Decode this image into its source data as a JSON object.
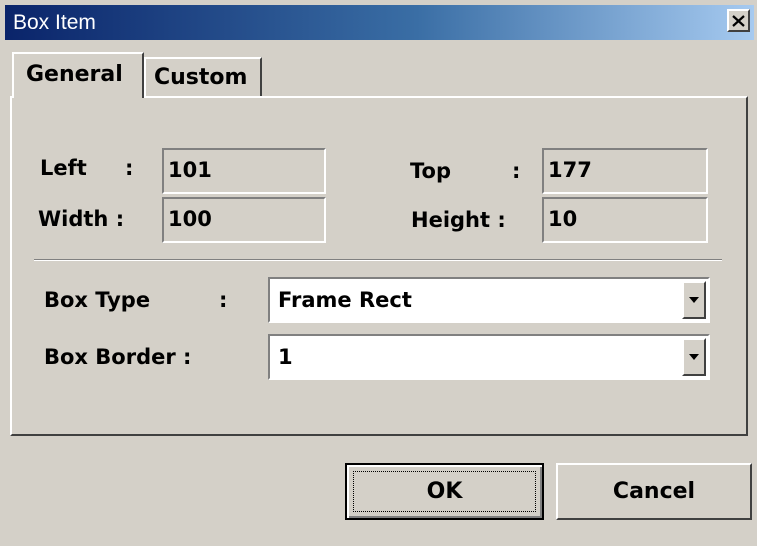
{
  "window": {
    "title": "Box Item",
    "close_glyph": "✕"
  },
  "tabs": [
    {
      "label": "General",
      "active": true
    },
    {
      "label": "Custom",
      "active": false
    }
  ],
  "position": {
    "left_label": "Left",
    "left_value": "101",
    "top_label": "Top",
    "top_value": "177",
    "width_label": "Width :",
    "width_value": "100",
    "height_label": "Height :",
    "height_value": "10",
    "colon": ":"
  },
  "box": {
    "type_label": "Box Type",
    "type_value": "Frame Rect",
    "border_label": "Box Border :",
    "border_value": "1",
    "colon": ":"
  },
  "buttons": {
    "ok_label": "OK",
    "cancel_label": "Cancel"
  },
  "colors": {
    "face": "#d4d0c8",
    "title_start": "#0a246a",
    "title_end": "#a6caf0",
    "title_text": "#ffffff"
  },
  "icons": {
    "close": "close-icon",
    "dropdown": "chevron-down-icon"
  }
}
